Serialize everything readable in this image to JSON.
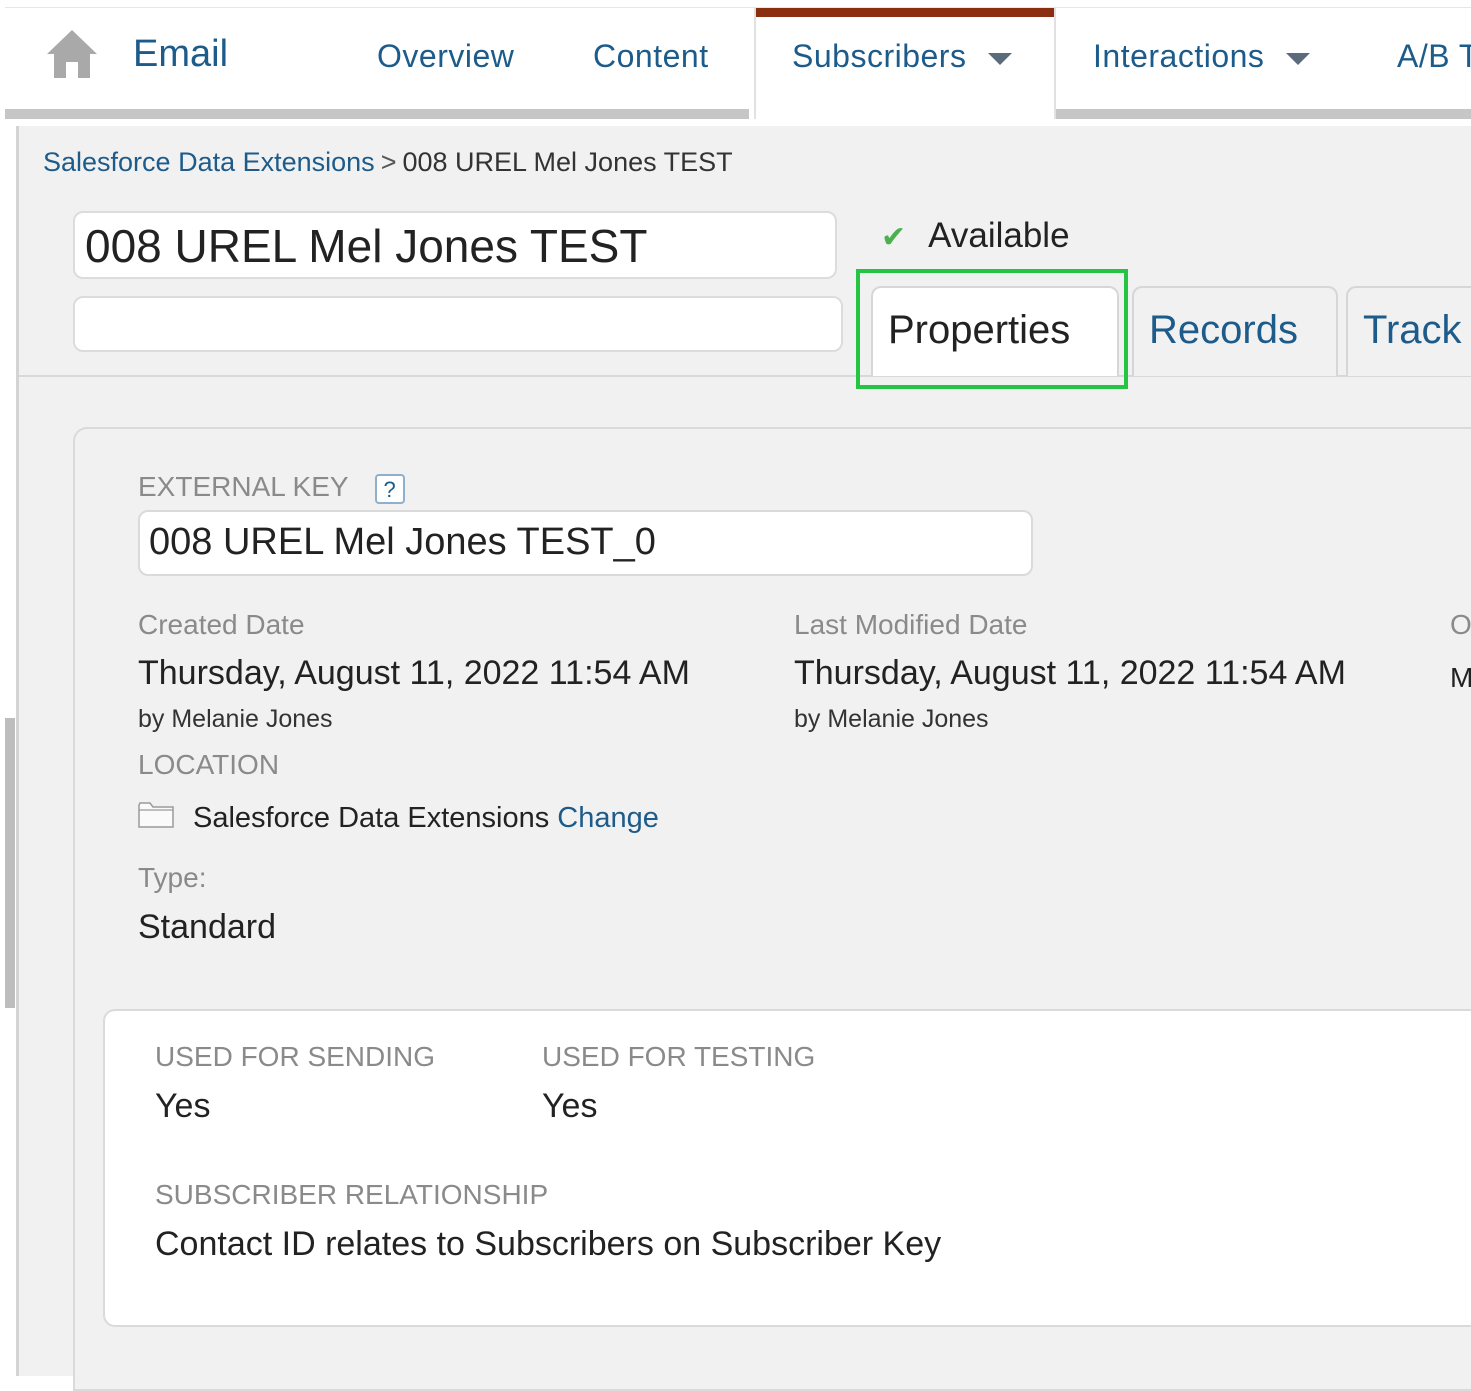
{
  "nav": {
    "app_title": "Email",
    "items": [
      {
        "label": "Overview"
      },
      {
        "label": "Content"
      },
      {
        "label": "Subscribers"
      },
      {
        "label": "Interactions"
      },
      {
        "label": "A/B T"
      }
    ]
  },
  "breadcrumb": {
    "parent": "Salesforce Data Extensions",
    "separator": ">",
    "current": "008 UREL Mel Jones TEST"
  },
  "header": {
    "name_value": "008 UREL Mel Jones TEST",
    "description_value": "",
    "status": "Available"
  },
  "tabs": [
    {
      "label": "Properties"
    },
    {
      "label": "Records"
    },
    {
      "label": "Track"
    }
  ],
  "properties": {
    "external_key_label": "EXTERNAL KEY",
    "help_glyph": "?",
    "external_key_value": "008 UREL Mel Jones TEST_0",
    "created_label": "Created Date",
    "created_value": "Thursday, August 11, 2022 11:54 AM",
    "created_by": "by Melanie Jones",
    "modified_label": "Last Modified Date",
    "modified_value": "Thursday, August 11, 2022 11:54 AM",
    "modified_by": "by Melanie Jones",
    "owner_label_partial": "O",
    "owner_value_partial": "M",
    "location_label": "LOCATION",
    "location_value": "Salesforce Data Extensions",
    "location_change": "Change",
    "type_label": "Type:",
    "type_value": "Standard"
  },
  "usage": {
    "sending_label": "USED FOR SENDING",
    "sending_value": "Yes",
    "testing_label": "USED FOR TESTING",
    "testing_value": "Yes",
    "relationship_label": "SUBSCRIBER RELATIONSHIP",
    "relationship_value": "Contact ID relates to Subscribers on Subscriber Key"
  },
  "colors": {
    "link": "#1d5b8a",
    "accent": "#8b2e10",
    "highlight": "#25c443",
    "status_check": "#4caf50"
  },
  "icons": [
    "home-icon",
    "chevron-down-icon",
    "check-icon",
    "help-icon",
    "folder-icon"
  ]
}
